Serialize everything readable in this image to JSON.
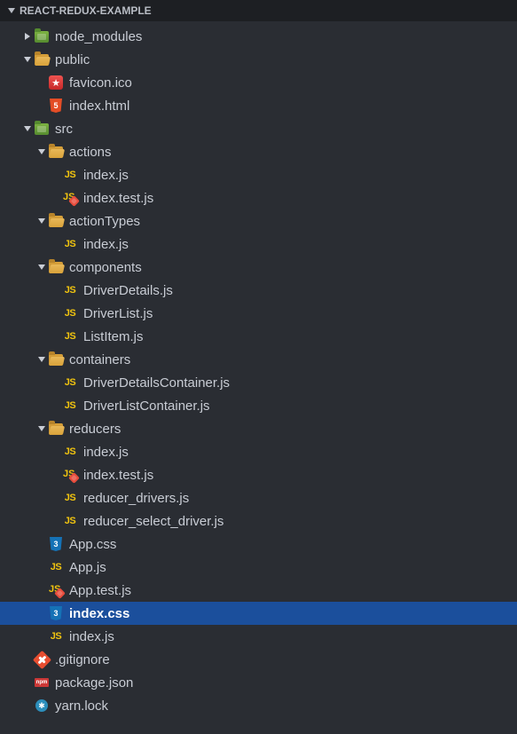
{
  "header": {
    "title": "REACT-REDUX-EXAMPLE"
  },
  "tree": [
    {
      "depth": 1,
      "arrow": "right",
      "icon": "pkg-green",
      "label": "node_modules",
      "interact": true
    },
    {
      "depth": 1,
      "arrow": "down",
      "icon": "folder-open",
      "label": "public",
      "interact": true
    },
    {
      "depth": 2,
      "arrow": "",
      "icon": "favicon",
      "label": "favicon.ico",
      "interact": true
    },
    {
      "depth": 2,
      "arrow": "",
      "icon": "html5",
      "label": "index.html",
      "interact": true
    },
    {
      "depth": 1,
      "arrow": "down",
      "icon": "pkg-green",
      "label": "src",
      "interact": true
    },
    {
      "depth": 2,
      "arrow": "down",
      "icon": "folder-open",
      "label": "actions",
      "interact": true
    },
    {
      "depth": 3,
      "arrow": "",
      "icon": "js",
      "label": "index.js",
      "interact": true
    },
    {
      "depth": 3,
      "arrow": "",
      "icon": "jstest",
      "label": "index.test.js",
      "interact": true
    },
    {
      "depth": 2,
      "arrow": "down",
      "icon": "folder-open",
      "label": "actionTypes",
      "interact": true
    },
    {
      "depth": 3,
      "arrow": "",
      "icon": "js",
      "label": "index.js",
      "interact": true
    },
    {
      "depth": 2,
      "arrow": "down",
      "icon": "folder-open",
      "label": "components",
      "interact": true
    },
    {
      "depth": 3,
      "arrow": "",
      "icon": "js",
      "label": "DriverDetails.js",
      "interact": true
    },
    {
      "depth": 3,
      "arrow": "",
      "icon": "js",
      "label": "DriverList.js",
      "interact": true
    },
    {
      "depth": 3,
      "arrow": "",
      "icon": "js",
      "label": "ListItem.js",
      "interact": true
    },
    {
      "depth": 2,
      "arrow": "down",
      "icon": "folder-open",
      "label": "containers",
      "interact": true
    },
    {
      "depth": 3,
      "arrow": "",
      "icon": "js",
      "label": "DriverDetailsContainer.js",
      "interact": true
    },
    {
      "depth": 3,
      "arrow": "",
      "icon": "js",
      "label": "DriverListContainer.js",
      "interact": true
    },
    {
      "depth": 2,
      "arrow": "down",
      "icon": "folder-open",
      "label": "reducers",
      "interact": true
    },
    {
      "depth": 3,
      "arrow": "",
      "icon": "js",
      "label": "index.js",
      "interact": true
    },
    {
      "depth": 3,
      "arrow": "",
      "icon": "jstest",
      "label": "index.test.js",
      "interact": true
    },
    {
      "depth": 3,
      "arrow": "",
      "icon": "js",
      "label": "reducer_drivers.js",
      "interact": true
    },
    {
      "depth": 3,
      "arrow": "",
      "icon": "js",
      "label": "reducer_select_driver.js",
      "interact": true
    },
    {
      "depth": 2,
      "arrow": "",
      "icon": "css3",
      "label": "App.css",
      "interact": true
    },
    {
      "depth": 2,
      "arrow": "",
      "icon": "js",
      "label": "App.js",
      "interact": true
    },
    {
      "depth": 2,
      "arrow": "",
      "icon": "jstest",
      "label": "App.test.js",
      "interact": true
    },
    {
      "depth": 2,
      "arrow": "",
      "icon": "css3",
      "label": "index.css",
      "interact": true,
      "selected": true,
      "bold": true
    },
    {
      "depth": 2,
      "arrow": "",
      "icon": "js",
      "label": "index.js",
      "interact": true
    },
    {
      "depth": 1,
      "arrow": "",
      "icon": "git",
      "label": ".gitignore",
      "interact": true
    },
    {
      "depth": 1,
      "arrow": "",
      "icon": "npm",
      "label": "package.json",
      "interact": true
    },
    {
      "depth": 1,
      "arrow": "",
      "icon": "yarn",
      "label": "yarn.lock",
      "interact": true
    }
  ]
}
